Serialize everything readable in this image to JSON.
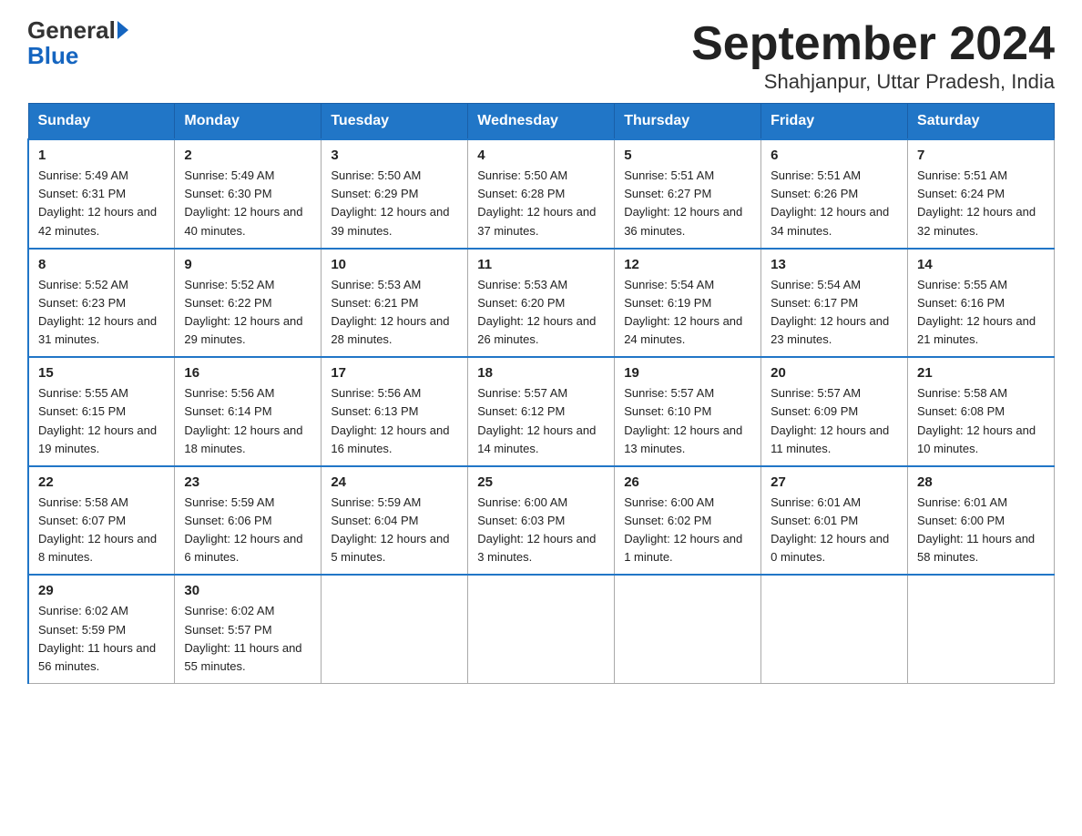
{
  "logo": {
    "general": "General",
    "blue": "Blue"
  },
  "title": "September 2024",
  "subtitle": "Shahjanpur, Uttar Pradesh, India",
  "days_of_week": [
    "Sunday",
    "Monday",
    "Tuesday",
    "Wednesday",
    "Thursday",
    "Friday",
    "Saturday"
  ],
  "weeks": [
    [
      {
        "day": 1,
        "sunrise": "5:49 AM",
        "sunset": "6:31 PM",
        "daylight": "12 hours and 42 minutes"
      },
      {
        "day": 2,
        "sunrise": "5:49 AM",
        "sunset": "6:30 PM",
        "daylight": "12 hours and 40 minutes"
      },
      {
        "day": 3,
        "sunrise": "5:50 AM",
        "sunset": "6:29 PM",
        "daylight": "12 hours and 39 minutes"
      },
      {
        "day": 4,
        "sunrise": "5:50 AM",
        "sunset": "6:28 PM",
        "daylight": "12 hours and 37 minutes"
      },
      {
        "day": 5,
        "sunrise": "5:51 AM",
        "sunset": "6:27 PM",
        "daylight": "12 hours and 36 minutes"
      },
      {
        "day": 6,
        "sunrise": "5:51 AM",
        "sunset": "6:26 PM",
        "daylight": "12 hours and 34 minutes"
      },
      {
        "day": 7,
        "sunrise": "5:51 AM",
        "sunset": "6:24 PM",
        "daylight": "12 hours and 32 minutes"
      }
    ],
    [
      {
        "day": 8,
        "sunrise": "5:52 AM",
        "sunset": "6:23 PM",
        "daylight": "12 hours and 31 minutes"
      },
      {
        "day": 9,
        "sunrise": "5:52 AM",
        "sunset": "6:22 PM",
        "daylight": "12 hours and 29 minutes"
      },
      {
        "day": 10,
        "sunrise": "5:53 AM",
        "sunset": "6:21 PM",
        "daylight": "12 hours and 28 minutes"
      },
      {
        "day": 11,
        "sunrise": "5:53 AM",
        "sunset": "6:20 PM",
        "daylight": "12 hours and 26 minutes"
      },
      {
        "day": 12,
        "sunrise": "5:54 AM",
        "sunset": "6:19 PM",
        "daylight": "12 hours and 24 minutes"
      },
      {
        "day": 13,
        "sunrise": "5:54 AM",
        "sunset": "6:17 PM",
        "daylight": "12 hours and 23 minutes"
      },
      {
        "day": 14,
        "sunrise": "5:55 AM",
        "sunset": "6:16 PM",
        "daylight": "12 hours and 21 minutes"
      }
    ],
    [
      {
        "day": 15,
        "sunrise": "5:55 AM",
        "sunset": "6:15 PM",
        "daylight": "12 hours and 19 minutes"
      },
      {
        "day": 16,
        "sunrise": "5:56 AM",
        "sunset": "6:14 PM",
        "daylight": "12 hours and 18 minutes"
      },
      {
        "day": 17,
        "sunrise": "5:56 AM",
        "sunset": "6:13 PM",
        "daylight": "12 hours and 16 minutes"
      },
      {
        "day": 18,
        "sunrise": "5:57 AM",
        "sunset": "6:12 PM",
        "daylight": "12 hours and 14 minutes"
      },
      {
        "day": 19,
        "sunrise": "5:57 AM",
        "sunset": "6:10 PM",
        "daylight": "12 hours and 13 minutes"
      },
      {
        "day": 20,
        "sunrise": "5:57 AM",
        "sunset": "6:09 PM",
        "daylight": "12 hours and 11 minutes"
      },
      {
        "day": 21,
        "sunrise": "5:58 AM",
        "sunset": "6:08 PM",
        "daylight": "12 hours and 10 minutes"
      }
    ],
    [
      {
        "day": 22,
        "sunrise": "5:58 AM",
        "sunset": "6:07 PM",
        "daylight": "12 hours and 8 minutes"
      },
      {
        "day": 23,
        "sunrise": "5:59 AM",
        "sunset": "6:06 PM",
        "daylight": "12 hours and 6 minutes"
      },
      {
        "day": 24,
        "sunrise": "5:59 AM",
        "sunset": "6:04 PM",
        "daylight": "12 hours and 5 minutes"
      },
      {
        "day": 25,
        "sunrise": "6:00 AM",
        "sunset": "6:03 PM",
        "daylight": "12 hours and 3 minutes"
      },
      {
        "day": 26,
        "sunrise": "6:00 AM",
        "sunset": "6:02 PM",
        "daylight": "12 hours and 1 minute"
      },
      {
        "day": 27,
        "sunrise": "6:01 AM",
        "sunset": "6:01 PM",
        "daylight": "12 hours and 0 minutes"
      },
      {
        "day": 28,
        "sunrise": "6:01 AM",
        "sunset": "6:00 PM",
        "daylight": "11 hours and 58 minutes"
      }
    ],
    [
      {
        "day": 29,
        "sunrise": "6:02 AM",
        "sunset": "5:59 PM",
        "daylight": "11 hours and 56 minutes"
      },
      {
        "day": 30,
        "sunrise": "6:02 AM",
        "sunset": "5:57 PM",
        "daylight": "11 hours and 55 minutes"
      },
      null,
      null,
      null,
      null,
      null
    ]
  ]
}
